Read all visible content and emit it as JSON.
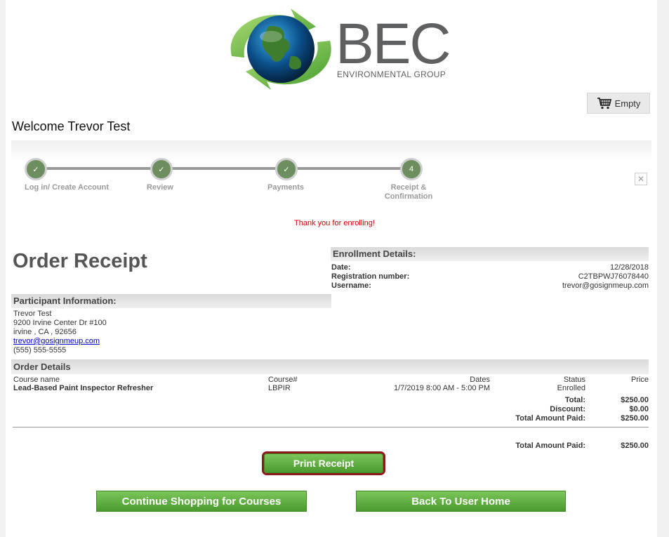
{
  "logo": {
    "brand": "BEC",
    "subtitle": "ENVIRONMENTAL GROUP"
  },
  "cart": {
    "label": "Empty",
    "icon": "cart-icon"
  },
  "welcome": "Welcome Trevor Test",
  "steps": [
    {
      "label": "Log in/ Create Account",
      "marker": "✓",
      "state": "done"
    },
    {
      "label": "Review",
      "marker": "✓",
      "state": "done"
    },
    {
      "label": "Payments",
      "marker": "✓",
      "state": "done"
    },
    {
      "label": "Receipt & Confirmation",
      "marker": "4",
      "state": "current"
    }
  ],
  "close_glyph": "✕",
  "thank_you": "Thank you for enrolling!",
  "receipt_title": "Order Receipt",
  "enrollment": {
    "heading": "Enrollment Details:",
    "date_label": "Date:",
    "date_value": "12/28/2018",
    "reg_label": "Registration number:",
    "reg_value": "C2TBPWJ76078440",
    "user_label": "Username:",
    "user_value": "trevor@gosignmeup.com"
  },
  "participant": {
    "heading": "Participant Information:",
    "name": "Trevor Test",
    "address1": "9200 Irvine Center Dr #100",
    "address2": "irvine , CA , 92656",
    "email": "trevor@gosignmeup.com",
    "phone": "(555) 555-5555"
  },
  "order": {
    "heading": "Order Details",
    "columns": {
      "name": "Course name",
      "course": "Course#",
      "dates": "Dates",
      "status": "Status",
      "price": "Price"
    },
    "rows": [
      {
        "name": "Lead-Based Paint Inspector Refresher",
        "course": "LBPIR",
        "dates": "1/7/2019 8:00 AM - 5:00 PM",
        "status": "Enrolled",
        "price": ""
      }
    ],
    "total_label": "Total:",
    "total_value": "$250.00",
    "discount_label": "Discount:",
    "discount_value": "$0.00",
    "paid_label": "Total Amount Paid:",
    "paid_value": "$250.00",
    "grand_label": "Total Amount Paid:",
    "grand_value": "$250.00"
  },
  "buttons": {
    "print": "Print Receipt",
    "continue": "Continue Shopping for Courses",
    "home": "Back To User Home"
  },
  "colors": {
    "accent_green": "#5aab3a",
    "alert_red": "#d40000",
    "highlight": "#8b1a1a"
  }
}
